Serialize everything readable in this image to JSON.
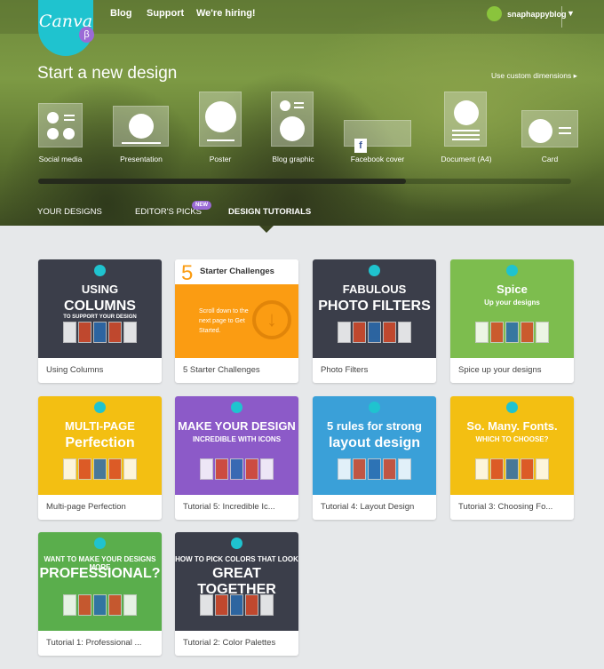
{
  "header": {
    "logo": "Canva",
    "beta": "β",
    "nav": [
      "Blog",
      "Support",
      "We're hiring!"
    ],
    "username": "snaphappyblog"
  },
  "start": {
    "title": "Start a new design",
    "custom": "Use custom dimensions ▸",
    "types": [
      "Social media",
      "Presentation",
      "Poster",
      "Blog graphic",
      "Facebook cover",
      "Document (A4)",
      "Card"
    ],
    "facebook_glyph": "f"
  },
  "tabs": {
    "your_designs": "YOUR DESIGNS",
    "editors_picks": "EDITOR'S PICKS",
    "new_badge": "NEW",
    "tutorials": "DESIGN TUTORIALS"
  },
  "cards": [
    {
      "label": "Using Columns",
      "bg": "#3b3e4a",
      "l1": "USING",
      "l2": "COLUMNS",
      "l3": "TO SUPPORT YOUR DESIGN"
    },
    {
      "label": "5 Starter Challenges",
      "bg": "#fb9c12",
      "num": "5",
      "head": "Starter Challenges",
      "body": "Scroll down to the next page to Get Started."
    },
    {
      "label": "Photo Filters",
      "bg": "#3b3e4a",
      "l1": "FABULOUS",
      "l2": "PHOTO FILTERS"
    },
    {
      "label": "Spice up your designs",
      "bg": "#7dbd4e",
      "l1": "Spice",
      "l2": "Up your designs"
    },
    {
      "label": "Multi-page Perfection",
      "bg": "#f3bf12",
      "l1": "MULTI-PAGE",
      "l2": "Perfection"
    },
    {
      "label": "Tutorial 5: Incredible Ic...",
      "bg": "#8c5ac8",
      "l1": "MAKE YOUR DESIGN",
      "l2": "INCREDIBLE WITH ICONS"
    },
    {
      "label": "Tutorial 4: Layout Design",
      "bg": "#3aa0d8",
      "l1": "5 rules for strong",
      "l2": "layout design"
    },
    {
      "label": "Tutorial 3: Choosing Fo...",
      "bg": "#f3bf12",
      "l1": "So. Many. Fonts.",
      "l2": "WHICH TO CHOOSE?"
    },
    {
      "label": "Tutorial 1: Professional ...",
      "bg": "#5aae4c",
      "l1": "WANT TO MAKE YOUR DESIGNS MORE",
      "l2": "PROFESSIONAL?"
    },
    {
      "label": "Tutorial 2: Color Palettes",
      "bg": "#3b3e4a",
      "l1": "HOW TO PICK COLORS THAT LOOK",
      "l2": "GREAT TOGETHER"
    }
  ]
}
